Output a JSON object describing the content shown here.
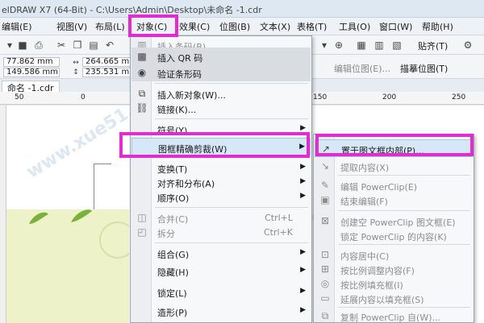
{
  "titlebar": {
    "title": "elDRAW X7 (64-Bit) - C:\\Users\\Admin\\Desktop\\未命名 -1.cdr"
  },
  "menubar": {
    "items": [
      "编辑(E)",
      "视图(V)",
      "布局(L)",
      "对象(C)",
      "效果(C)",
      "位图(B)",
      "文本(X)",
      "表格(T)",
      "工具(O)",
      "窗口(W)",
      "帮助(H)"
    ]
  },
  "toolbar": {
    "snap_label": "贴齐(T)"
  },
  "propbar": {
    "x": "77.862 mm",
    "y": "149.586 mm",
    "w": "264.665 mm",
    "h": "235.531 mm",
    "edit_bitmap": "编辑位图(E)...",
    "trace_bitmap": "描摹位图(T)"
  },
  "doctab": {
    "name": "命名 -1.cdr"
  },
  "ruler": {
    "ticks": [
      "50",
      "0",
      "150",
      "200",
      "250"
    ]
  },
  "object_menu": {
    "items": [
      {
        "label": "插入条码(B)...",
        "disabled": true,
        "icon": "barcode-icon"
      },
      {
        "label": "插入 QR 码",
        "disabled": false,
        "icon": "qr-code-icon"
      },
      {
        "label": "验证条形码",
        "disabled": false,
        "icon": "verify-barcode-icon"
      },
      {
        "label": "插入新对象(W)...",
        "disabled": false,
        "icon": "insert-object-icon"
      },
      {
        "label": "链接(K)...",
        "disabled": false,
        "icon": "link-icon"
      },
      {
        "label": "符号(Y)",
        "disabled": false,
        "submenu": true
      },
      {
        "label": "图框精确剪裁(W)",
        "disabled": false,
        "submenu": true,
        "highlighted": true
      },
      {
        "label": "变换(T)",
        "disabled": false,
        "submenu": true
      },
      {
        "label": "对齐和分布(A)",
        "disabled": false,
        "submenu": true
      },
      {
        "label": "顺序(O)",
        "disabled": false,
        "submenu": true
      },
      {
        "label": "合并(C)",
        "disabled": true,
        "shortcut": "Ctrl+L",
        "icon": "combine-icon"
      },
      {
        "label": "拆分",
        "disabled": true,
        "shortcut": "Ctrl+K",
        "icon": "break-apart-icon"
      },
      {
        "label": "组合(G)",
        "disabled": false,
        "submenu": true
      },
      {
        "label": "隐藏(H)",
        "disabled": false,
        "submenu": true
      },
      {
        "label": "锁定(L)",
        "disabled": false,
        "submenu": true
      },
      {
        "label": "造形(P)",
        "disabled": false,
        "submenu": true
      }
    ]
  },
  "powerclip_menu": {
    "items": [
      {
        "label": "置于图文框内部(P)...",
        "disabled": false,
        "highlighted": true,
        "icon": "place-inside-frame-icon"
      },
      {
        "label": "提取内容(X)",
        "disabled": true,
        "icon": "extract-contents-icon"
      },
      {
        "label": "编辑 PowerClip(E)",
        "disabled": true,
        "icon": "edit-powerclip-icon"
      },
      {
        "label": "结束编辑(F)",
        "disabled": true,
        "icon": "finish-editing-icon"
      },
      {
        "label": "创建空 PowerClip 图文框(E)",
        "disabled": true,
        "icon": "empty-frame-icon"
      },
      {
        "label": "锁定 PowerClip 的内容(K)",
        "disabled": true,
        "icon": "lock-contents-icon"
      },
      {
        "label": "内容居中(C)",
        "disabled": true,
        "icon": "center-contents-icon"
      },
      {
        "label": "按比例调整内容(F)",
        "disabled": true,
        "icon": "fit-contents-icon"
      },
      {
        "label": "按比例填充框(I)",
        "disabled": true,
        "icon": "fill-frame-icon"
      },
      {
        "label": "延展内容以填充框(S)",
        "disabled": true,
        "icon": "stretch-contents-icon"
      },
      {
        "label": "复制 PowerClip 自(W)...",
        "disabled": true,
        "icon": "copy-powerclip-icon"
      }
    ]
  },
  "watermark": {
    "text": "www.xue51.com"
  }
}
